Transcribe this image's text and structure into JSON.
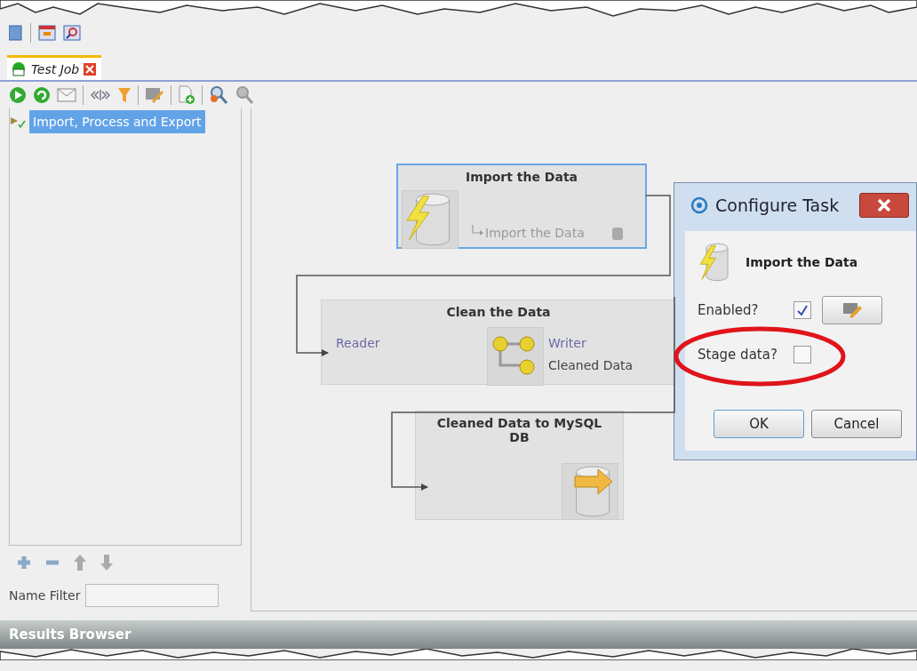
{
  "tabs": [
    {
      "label": "Test Job",
      "selected": true
    }
  ],
  "tree": [
    {
      "label": "Import, Process and Export",
      "selected": true
    }
  ],
  "name_filter": {
    "label": "Name Filter"
  },
  "nodes": [
    {
      "kind": "import",
      "title": "Import the Data",
      "selected": true,
      "output": "Import the Data"
    },
    {
      "kind": "transform",
      "title": "Clean the Data",
      "selected": false,
      "input": "Reader",
      "output_label": "Writer",
      "output": "Cleaned Data"
    },
    {
      "kind": "export",
      "title": "Cleaned Data to MySQL DB",
      "selected": false
    }
  ],
  "dialog": {
    "title": "Configure Task",
    "task": "Import the Data",
    "fields": [
      {
        "label": "Enabled?",
        "checked": true
      },
      {
        "label": "Stage data?",
        "checked": false
      }
    ],
    "buttons": [
      "OK",
      "Cancel"
    ]
  },
  "results_panel": {
    "title": "Results Browser"
  }
}
